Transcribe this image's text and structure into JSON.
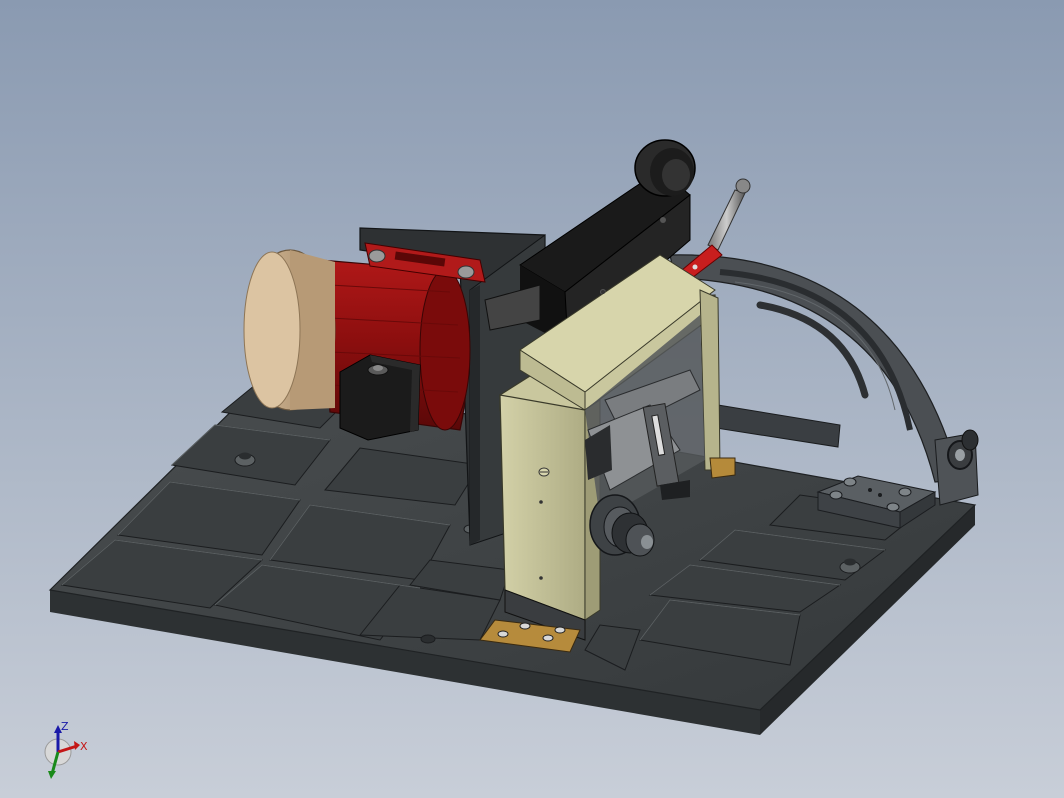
{
  "viewport": {
    "background_top": "#8d9db4",
    "background_bottom": "#c6ccd6",
    "model_colors": {
      "base_plate": "#3f4345",
      "base_edge": "#2b2e30",
      "motor_red": "#8e0f0f",
      "motor_cap": "#c8aa86",
      "frame_khaki": "#c9c79e",
      "black_part": "#1c1c1c",
      "handle_red": "#c81e1e",
      "brass": "#b58a3a",
      "arc_guide": "#4a4e52"
    }
  },
  "triad": {
    "z_label": "Z",
    "x_label": "X",
    "z_color": "#1a1aa8",
    "x_color": "#c41616",
    "y_color": "#1a8a1a"
  }
}
